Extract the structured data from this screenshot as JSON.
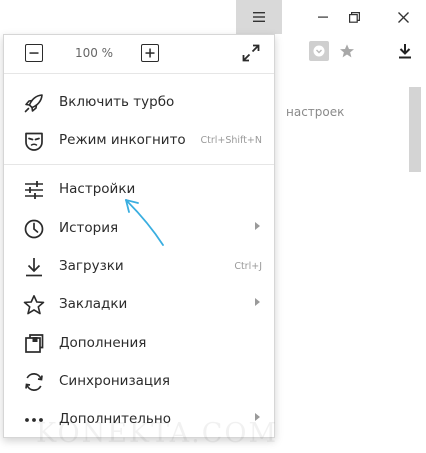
{
  "window": {
    "menu_icon": "hamburger-icon",
    "minimize_icon": "minimize-icon",
    "restore_icon": "restore-icon",
    "close_icon": "close-icon"
  },
  "toolbar": {
    "icons": [
      "protect-icon",
      "star-icon",
      "download-icon"
    ]
  },
  "page": {
    "background_text": "настроек"
  },
  "menu": {
    "zoom": {
      "value": "100 %",
      "minus_icon": "minus-icon",
      "plus_icon": "plus-icon",
      "fullscreen_icon": "fullscreen-icon"
    },
    "items": [
      {
        "label": "Включить турбо",
        "icon": "rocket-icon",
        "shortcut": "",
        "submenu": false
      },
      {
        "label": "Режим инкогнито",
        "icon": "incognito-mask-icon",
        "shortcut": "Ctrl+Shift+N",
        "submenu": false
      },
      {
        "label": "Настройки",
        "icon": "settings-sliders-icon",
        "shortcut": "",
        "submenu": false
      },
      {
        "label": "История",
        "icon": "clock-icon",
        "shortcut": "",
        "submenu": true
      },
      {
        "label": "Загрузки",
        "icon": "download-icon",
        "shortcut": "Ctrl+J",
        "submenu": false
      },
      {
        "label": "Закладки",
        "icon": "star-outline-icon",
        "shortcut": "",
        "submenu": true
      },
      {
        "label": "Дополнения",
        "icon": "extensions-icon",
        "shortcut": "",
        "submenu": false
      },
      {
        "label": "Синхронизация",
        "icon": "sync-icon",
        "shortcut": "",
        "submenu": false
      },
      {
        "label": "Дополнительно",
        "icon": "more-dots-icon",
        "shortcut": "",
        "submenu": true
      }
    ]
  },
  "colors": {
    "menu_bg": "#ffffff",
    "text": "#2b2b2b",
    "shortcut": "#9a9a9a",
    "annotation_arrow": "#3aaee0",
    "active_menu_button": "#d9d9d9"
  },
  "watermark": "KONEKTA.COM"
}
